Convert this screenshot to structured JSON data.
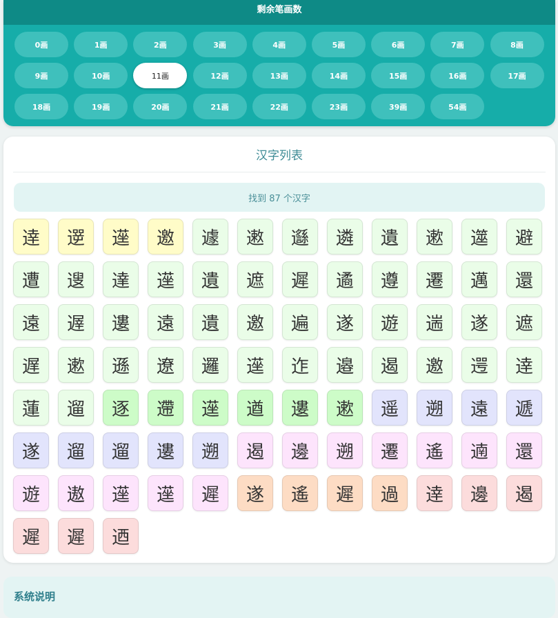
{
  "stroke_panel": {
    "title": "剩余笔画数",
    "options": [
      "0画",
      "1画",
      "2画",
      "3画",
      "4画",
      "5画",
      "6画",
      "7画",
      "8画",
      "9画",
      "10画",
      "11画",
      "12画",
      "13画",
      "14画",
      "15画",
      "16画",
      "17画",
      "18画",
      "19画",
      "20画",
      "21画",
      "22画",
      "23画",
      "39画",
      "54画"
    ],
    "selected": "11画"
  },
  "char_list": {
    "title": "汉字列表",
    "found_text": "找到 87 个汉字",
    "palette": {
      "yellow": "#fffcc8",
      "mint": "#eafde8",
      "green": "#cdfcc8",
      "lavender": "#e2e4fc",
      "pink": "#fde4fc",
      "peach": "#fddcc4",
      "rose": "#fcdcdc"
    },
    "chars": [
      {
        "c": "逹",
        "color": "yellow"
      },
      {
        "c": "遻",
        "color": "yellow"
      },
      {
        "c": "遳",
        "color": "yellow"
      },
      {
        "c": "邀",
        "color": "yellow"
      },
      {
        "c": "遽",
        "color": "mint"
      },
      {
        "c": "遫",
        "color": "mint"
      },
      {
        "c": "邎",
        "color": "mint"
      },
      {
        "c": "遴",
        "color": "mint"
      },
      {
        "c": "遺",
        "color": "mint"
      },
      {
        "c": "遬",
        "color": "mint"
      },
      {
        "c": "遾",
        "color": "mint"
      },
      {
        "c": "避",
        "color": "mint"
      },
      {
        "c": "遭",
        "color": "mint"
      },
      {
        "c": "遚",
        "color": "mint"
      },
      {
        "c": "達",
        "color": "mint"
      },
      {
        "c": "遳",
        "color": "mint"
      },
      {
        "c": "遺",
        "color": "mint"
      },
      {
        "c": "遮",
        "color": "mint"
      },
      {
        "c": "遲",
        "color": "mint"
      },
      {
        "c": "遹",
        "color": "mint"
      },
      {
        "c": "遵",
        "color": "mint"
      },
      {
        "c": "遷",
        "color": "mint"
      },
      {
        "c": "邁",
        "color": "mint"
      },
      {
        "c": "還",
        "color": "mint"
      },
      {
        "c": "遠",
        "color": "mint"
      },
      {
        "c": "遟",
        "color": "mint"
      },
      {
        "c": "遱",
        "color": "mint"
      },
      {
        "c": "遠",
        "color": "mint"
      },
      {
        "c": "遺",
        "color": "mint"
      },
      {
        "c": "邀",
        "color": "mint"
      },
      {
        "c": "遍",
        "color": "mint"
      },
      {
        "c": "遂",
        "color": "mint"
      },
      {
        "c": "遊",
        "color": "mint"
      },
      {
        "c": "遄",
        "color": "mint"
      },
      {
        "c": "遂",
        "color": "mint"
      },
      {
        "c": "遮",
        "color": "mint"
      },
      {
        "c": "遅",
        "color": "mint"
      },
      {
        "c": "遬",
        "color": "mint"
      },
      {
        "c": "遜",
        "color": "mint"
      },
      {
        "c": "遼",
        "color": "mint"
      },
      {
        "c": "邏",
        "color": "mint"
      },
      {
        "c": "遳",
        "color": "mint"
      },
      {
        "c": "迮",
        "color": "mint"
      },
      {
        "c": "邉",
        "color": "mint"
      },
      {
        "c": "遏",
        "color": "mint"
      },
      {
        "c": "邀",
        "color": "mint"
      },
      {
        "c": "遌",
        "color": "mint"
      },
      {
        "c": "逹",
        "color": "mint"
      },
      {
        "c": "蓮",
        "color": "mint"
      },
      {
        "c": "遛",
        "color": "mint"
      },
      {
        "c": "逐",
        "color": "green"
      },
      {
        "c": "遰",
        "color": "green"
      },
      {
        "c": "遳",
        "color": "green"
      },
      {
        "c": "遒",
        "color": "green"
      },
      {
        "c": "遱",
        "color": "green"
      },
      {
        "c": "遬",
        "color": "green"
      },
      {
        "c": "遥",
        "color": "lavender"
      },
      {
        "c": "遡",
        "color": "lavender"
      },
      {
        "c": "遠",
        "color": "lavender"
      },
      {
        "c": "遞",
        "color": "lavender"
      },
      {
        "c": "遂",
        "color": "lavender"
      },
      {
        "c": "遛",
        "color": "lavender"
      },
      {
        "c": "遛",
        "color": "lavender"
      },
      {
        "c": "遱",
        "color": "lavender"
      },
      {
        "c": "遡",
        "color": "lavender"
      },
      {
        "c": "遏",
        "color": "pink"
      },
      {
        "c": "邊",
        "color": "pink"
      },
      {
        "c": "遡",
        "color": "pink"
      },
      {
        "c": "遷",
        "color": "pink"
      },
      {
        "c": "遙",
        "color": "pink"
      },
      {
        "c": "遖",
        "color": "pink"
      },
      {
        "c": "還",
        "color": "pink"
      },
      {
        "c": "遊",
        "color": "pink"
      },
      {
        "c": "遨",
        "color": "pink"
      },
      {
        "c": "遳",
        "color": "pink"
      },
      {
        "c": "遳",
        "color": "pink"
      },
      {
        "c": "遲",
        "color": "pink"
      },
      {
        "c": "遂",
        "color": "peach"
      },
      {
        "c": "遙",
        "color": "peach"
      },
      {
        "c": "遲",
        "color": "peach"
      },
      {
        "c": "過",
        "color": "peach"
      },
      {
        "c": "逹",
        "color": "rose"
      },
      {
        "c": "邊",
        "color": "rose"
      },
      {
        "c": "遏",
        "color": "rose"
      },
      {
        "c": "遲",
        "color": "rose"
      },
      {
        "c": "遲",
        "color": "rose"
      },
      {
        "c": "迺",
        "color": "rose"
      }
    ]
  },
  "system": {
    "title": "系统说明"
  }
}
